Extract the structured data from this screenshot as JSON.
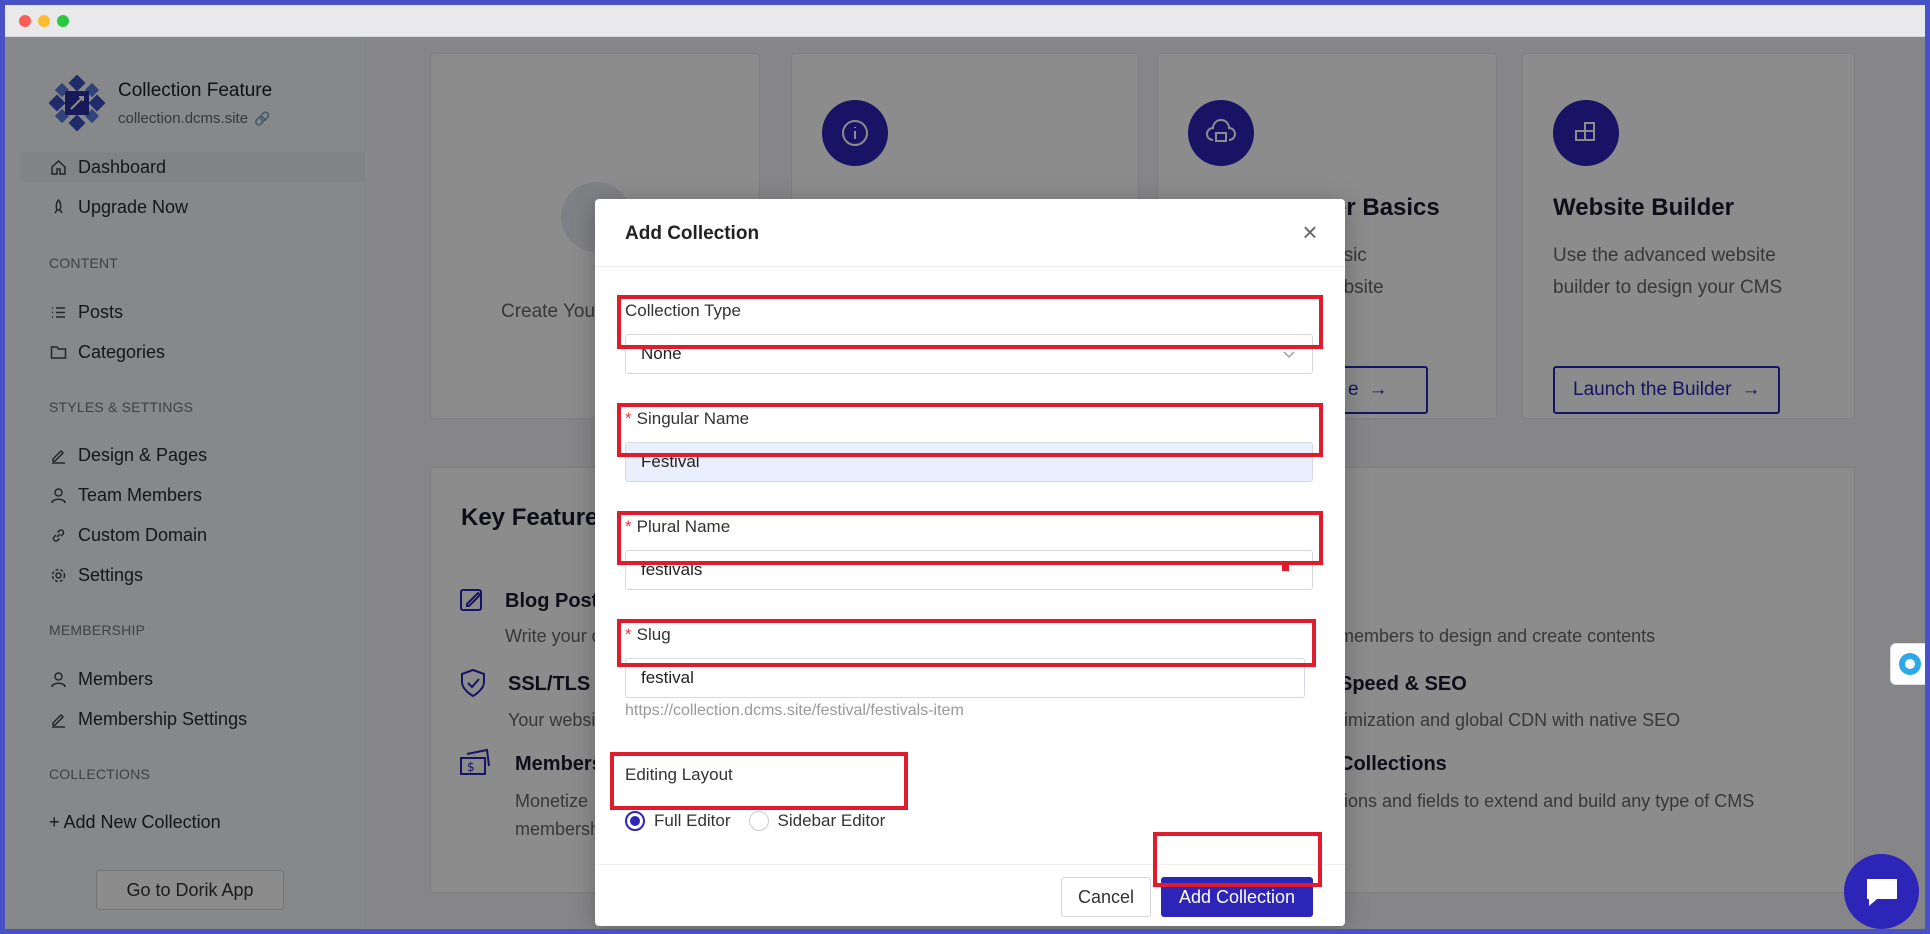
{
  "sidebar": {
    "brand_name": "Collection Feature",
    "brand_url": "collection.dcms.site",
    "items": [
      {
        "label": "Dashboard",
        "icon": "home-icon"
      },
      {
        "label": "Upgrade Now",
        "icon": "rocket-icon"
      }
    ],
    "content_header": "CONTENT",
    "content_items": [
      {
        "label": "Posts",
        "icon": "list-icon"
      },
      {
        "label": "Categories",
        "icon": "folder-icon"
      }
    ],
    "styles_header": "STYLES & SETTINGS",
    "styles_items": [
      {
        "label": "Design & Pages",
        "icon": "pen-icon"
      },
      {
        "label": "Team Members",
        "icon": "user-icon"
      },
      {
        "label": "Custom Domain",
        "icon": "link-icon"
      },
      {
        "label": "Settings",
        "icon": "gear-icon"
      }
    ],
    "membership_header": "MEMBERSHIP",
    "membership_items": [
      {
        "label": "Members",
        "icon": "user-icon"
      },
      {
        "label": "Membership Settings",
        "icon": "pen-icon"
      }
    ],
    "collections_header": "COLLECTIONS",
    "add_collection": "+ Add New Collection",
    "go_to_dorik": "Go to Dorik App"
  },
  "main": {
    "cards": [
      {
        "text": "Create You"
      },
      {
        "title": "",
        "icon": "info-icon"
      },
      {
        "title": "er Basics",
        "desc_1": "asic",
        "desc_2": "ebsite",
        "button": "e",
        "icon": "cloud-icon"
      },
      {
        "title": "Website Builder",
        "desc_1": "Use the advanced website",
        "desc_2": "builder to design your CMS",
        "button": "Launch the Builder",
        "icon": "blocks-icon"
      }
    ],
    "key_features_title": "Key Feature",
    "features": [
      {
        "title": "Blog Posts",
        "desc": "Write your c",
        "icon": "edit-icon"
      },
      {
        "title": "SSL/TLS C",
        "desc": "Your websit",
        "icon": "shield-icon"
      },
      {
        "title": "Members",
        "desc": "Monetize",
        "desc_2": "membersh",
        "icon": "ticket-icon"
      }
    ],
    "right_features": [
      {
        "title": "",
        "desc": "members to design and create contents"
      },
      {
        "title": "Speed & SEO",
        "desc": "timization and global CDN with native SEO"
      },
      {
        "title": "Collections",
        "desc": "tions and fields to extend and build any type of CMS"
      }
    ]
  },
  "modal": {
    "title": "Add Collection",
    "collection_type_label": "Collection Type",
    "collection_type_value": "None",
    "singular_label": "Singular Name",
    "singular_value": "Festival",
    "plural_label": "Plural Name",
    "plural_value": "festivals",
    "slug_label": "Slug",
    "slug_value": "festival",
    "slug_hint": "https://collection.dcms.site/festival/festivals-item",
    "layout_label": "Editing Layout",
    "layout_options": [
      "Full Editor",
      "Sidebar Editor"
    ],
    "layout_selected": "Full Editor",
    "required_mark": "*",
    "cancel": "Cancel",
    "submit": "Add Collection"
  },
  "colors": {
    "accent": "#2d24b8",
    "highlight": "#e01b2c"
  }
}
